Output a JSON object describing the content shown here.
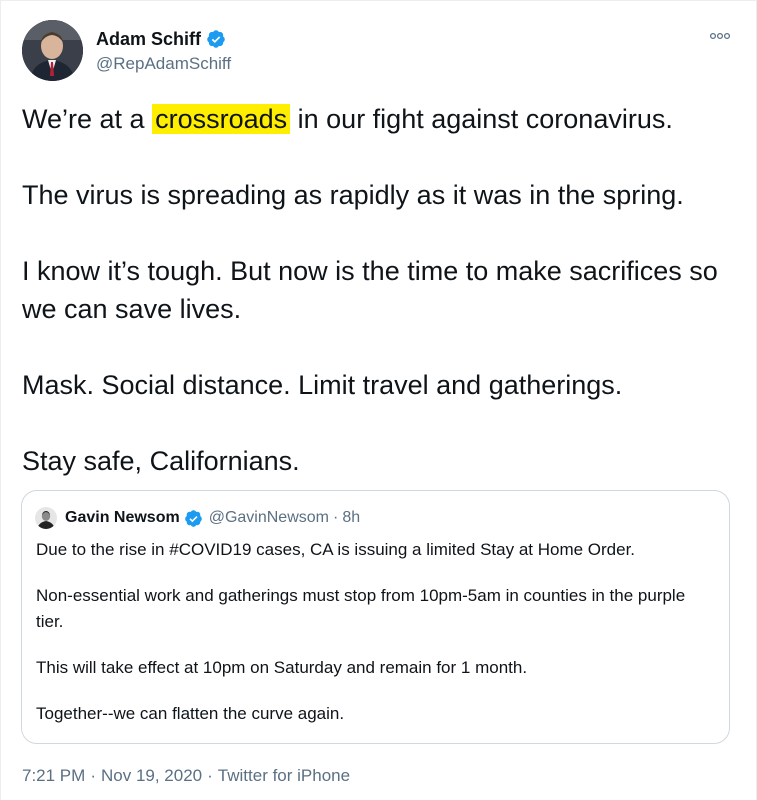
{
  "tweet": {
    "author_name": "Adam Schiff",
    "author_handle": "@RepAdamSchiff",
    "text_line1_before": "We’re at a",
    "text_line1_highlight": "crossroads",
    "text_line1_after": "in our fight against coronavirus.",
    "paragraph2": "The virus is spreading as rapidly as it was in the spring.",
    "paragraph3": "I know it’s tough. But now is the time to make sacrifices so we can save lives.",
    "paragraph4": "Mask. Social distance. Limit travel and gatherings.",
    "paragraph5": "Stay safe, Californians.",
    "highlight_color": "#ffee00"
  },
  "quoted_tweet": {
    "author_name": "Gavin Newsom",
    "author_handle": "@GavinNewsom",
    "separator": "·",
    "time": "8h",
    "paragraph1": "Due to the rise in #COVID19 cases, CA is issuing a limited Stay at Home Order.",
    "paragraph2": "Non-essential work and gatherings must stop from 10pm-5am in counties in the purple tier.",
    "paragraph3": "This will take effect at 10pm on Saturday and remain for 1 month.",
    "paragraph4": "Together--we can flatten the curve again."
  },
  "meta": {
    "time": "7:21 PM",
    "date": "Nov 19, 2020",
    "source": "Twitter for iPhone",
    "separator": "·"
  },
  "icons": {
    "verified": "verified-badge-icon",
    "more": "more-options-icon"
  },
  "colors": {
    "verified_blue": "#1d9bf0",
    "secondary_text": "#5b7083",
    "primary_text": "#0f1419",
    "border": "#cfd9de"
  }
}
